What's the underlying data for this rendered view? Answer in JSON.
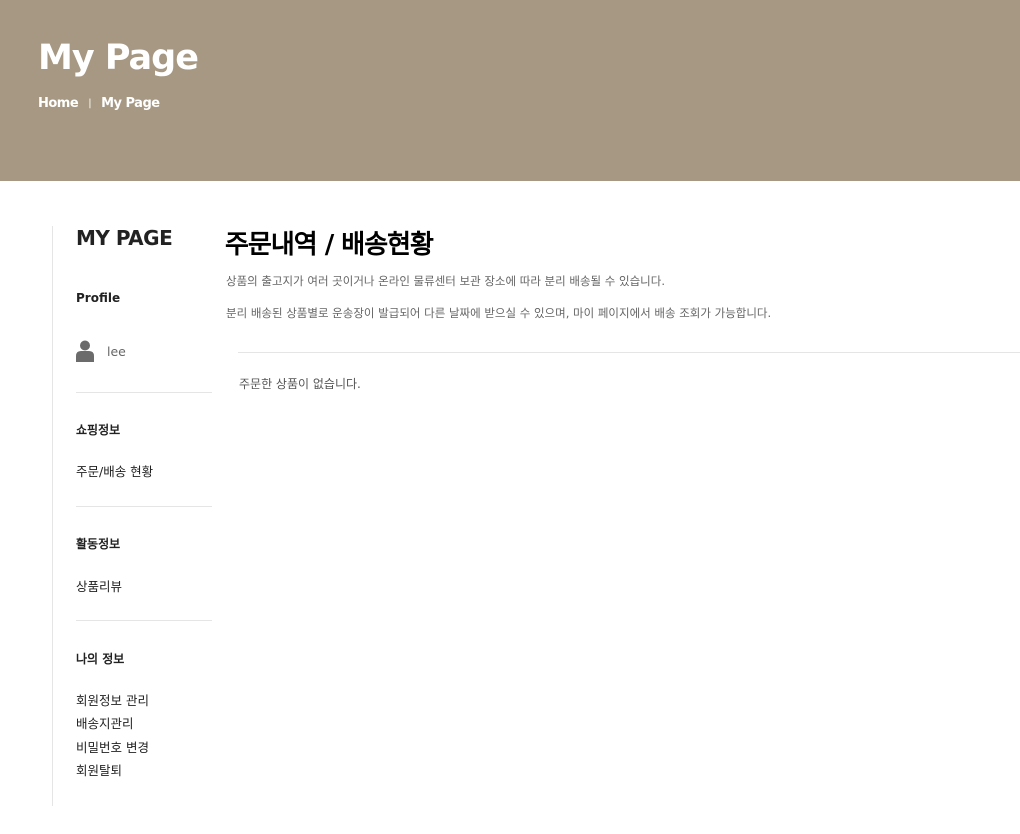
{
  "header": {
    "title": "My Page",
    "breadcrumb": [
      "Home",
      "My Page"
    ],
    "separator": "|"
  },
  "sidebar": {
    "title": "MY PAGE",
    "profile_heading": "Profile",
    "username": "lee",
    "sections": [
      {
        "heading": "쇼핑정보",
        "links": [
          "주문/배송 현황"
        ]
      },
      {
        "heading": "활동정보",
        "links": [
          "상품리뷰"
        ]
      },
      {
        "heading": "나의 정보",
        "links": [
          "회원정보 관리",
          "배송지관리",
          "비밀번호 변경",
          "회원탈퇴"
        ]
      }
    ]
  },
  "main": {
    "title": "주문내역 / 배송현황",
    "descriptions": [
      "상품의 출고지가 여러 곳이거나 온라인 물류센터 보관 장소에 따라 분리 배송될 수 있습니다.",
      "분리 배송된 상품별로 운송장이 발급되어 다른 날짜에 받으실 수 있으며, 마이 페이지에서 배송 조회가 가능합니다."
    ],
    "empty_message": "주문한 상품이 없습니다."
  },
  "colors": {
    "hero": "#a69882"
  }
}
